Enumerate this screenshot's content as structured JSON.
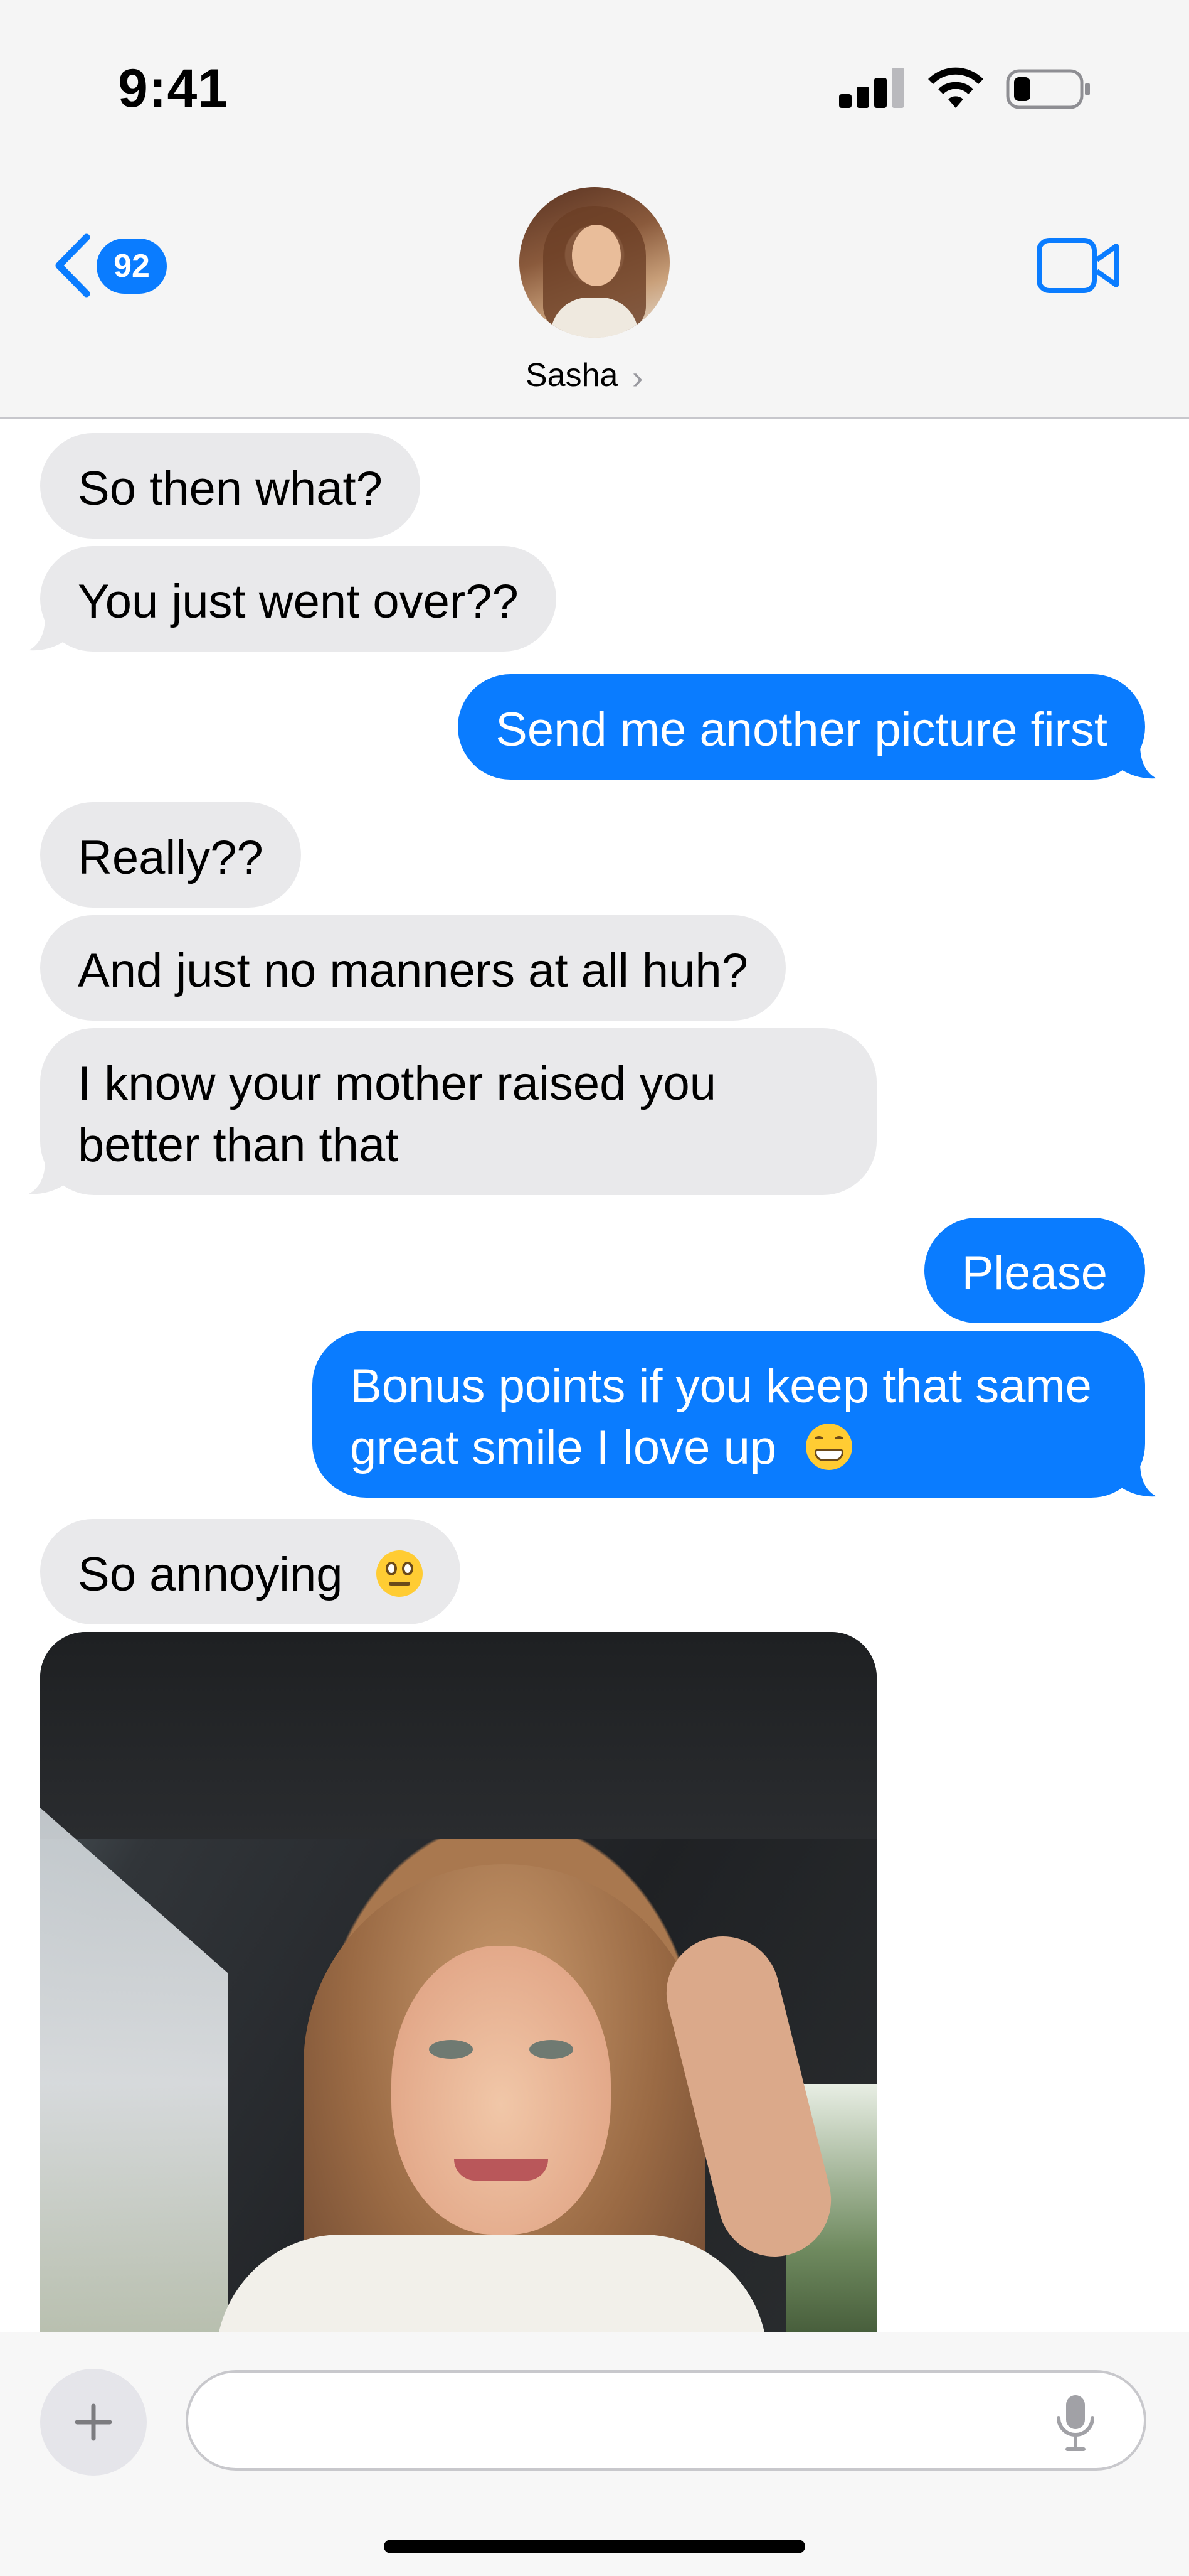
{
  "status_bar": {
    "time": "9:41"
  },
  "header": {
    "unread_count": "92",
    "contact_name": "Sasha",
    "contact_chevron": "›"
  },
  "messages": [
    {
      "from": "contact",
      "text": "So then what?"
    },
    {
      "from": "contact",
      "text": "You just went over??"
    },
    {
      "from": "me",
      "text": "Send me another picture first"
    },
    {
      "from": "contact",
      "text": "Really??"
    },
    {
      "from": "contact",
      "text": "And just no manners at all huh?"
    },
    {
      "from": "contact",
      "text": "I know your mother raised you better than that"
    },
    {
      "from": "me",
      "text": "Please"
    },
    {
      "from": "me",
      "text": "Bonus points if you keep that same great smile I love up",
      "emoji": "grimacing-face"
    },
    {
      "from": "contact",
      "text": "So annoying",
      "emoji": "face-with-rolling-eyes"
    },
    {
      "from": "contact",
      "type": "photo",
      "alt": "selfie"
    }
  ],
  "composer": {
    "value": "",
    "placeholder": ""
  },
  "colors": {
    "sent_bubble": "#0a7cff",
    "received_bubble": "#e9e9eb",
    "accent": "#0a7cff"
  },
  "icons": [
    "back-chevron-icon",
    "video-call-icon",
    "plus-icon",
    "microphone-icon",
    "cellular-signal-icon",
    "wifi-icon",
    "battery-icon"
  ]
}
